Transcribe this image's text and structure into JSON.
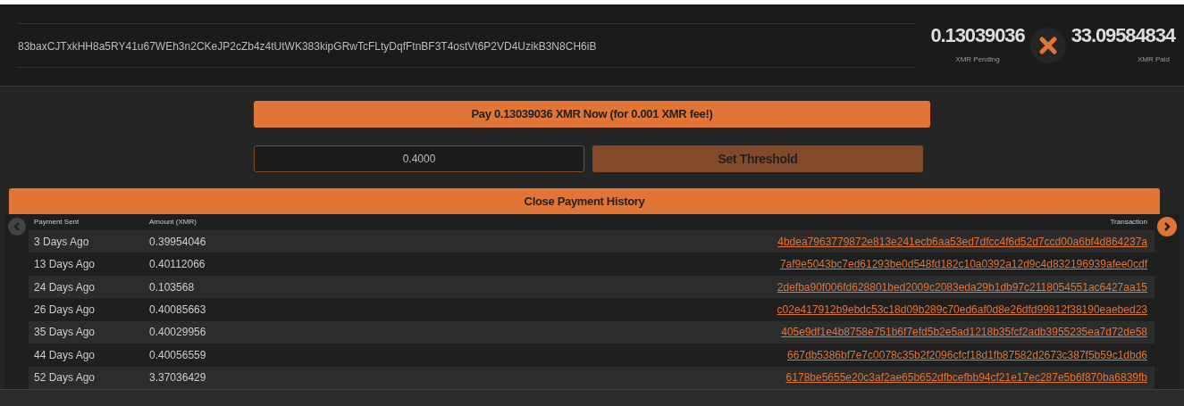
{
  "header": {
    "address": "83baxCJTxkHH8a5RY41u67WEh3n2CKeJP2cZb4z4tUtWK383kipGRwTcFLtyDqfFtnBF3T4ostVt6P2VD4UzikB3N8CH6iB",
    "pending": {
      "value": "0.13039036",
      "label": "XMR Pending"
    },
    "paid": {
      "value": "33.09584834",
      "label": "XMR Paid"
    }
  },
  "pay_button": "Pay 0.13039036 XMR Now (for 0.001 XMR fee!)",
  "threshold": {
    "value": "0.4000",
    "button": "Set Threshold"
  },
  "history_button": "Close Payment History",
  "table": {
    "columns": [
      "Payment Sent",
      "Amount (XMR)",
      "Transaction"
    ],
    "rows": [
      {
        "sent": "3 Days Ago",
        "amount": "0.39954046",
        "tx": "4bdea7963779872e813e241ecb6aa53ed7dfcc4f6d52d7ccd00a6bf4d864237a"
      },
      {
        "sent": "13 Days Ago",
        "amount": "0.40112066",
        "tx": "7af9e5043bc7ed61293be0d548fd182c10a0392a12d9c4d832196939afee0cdf"
      },
      {
        "sent": "24 Days Ago",
        "amount": "0.103568",
        "tx": "2defba90f006fd628801bed2009c2083eda29b1db97c2118054551ac6427aa15"
      },
      {
        "sent": "26 Days Ago",
        "amount": "0.40085663",
        "tx": "c02e417912b9ebdc53c18d09b289c70ed6af0d8e26dfd99812f38190eaebed23"
      },
      {
        "sent": "35 Days Ago",
        "amount": "0.40029956",
        "tx": "405e9df1e4b8758e751b6f7efd5b2e5ad1218b35fcf2adb3955235ea7d72de58"
      },
      {
        "sent": "44 Days Ago",
        "amount": "0.40056559",
        "tx": "667db5386bf7e7c0078c35b2f2096cfcf18d1fb87582d2673c387f5b59c1dbd6"
      },
      {
        "sent": "52 Days Ago",
        "amount": "3.37036429",
        "tx": "6178be5655e20c3af2ae65b652dfbcefbb94cf21e17ec287e5b6f870ba6839fb"
      }
    ]
  }
}
